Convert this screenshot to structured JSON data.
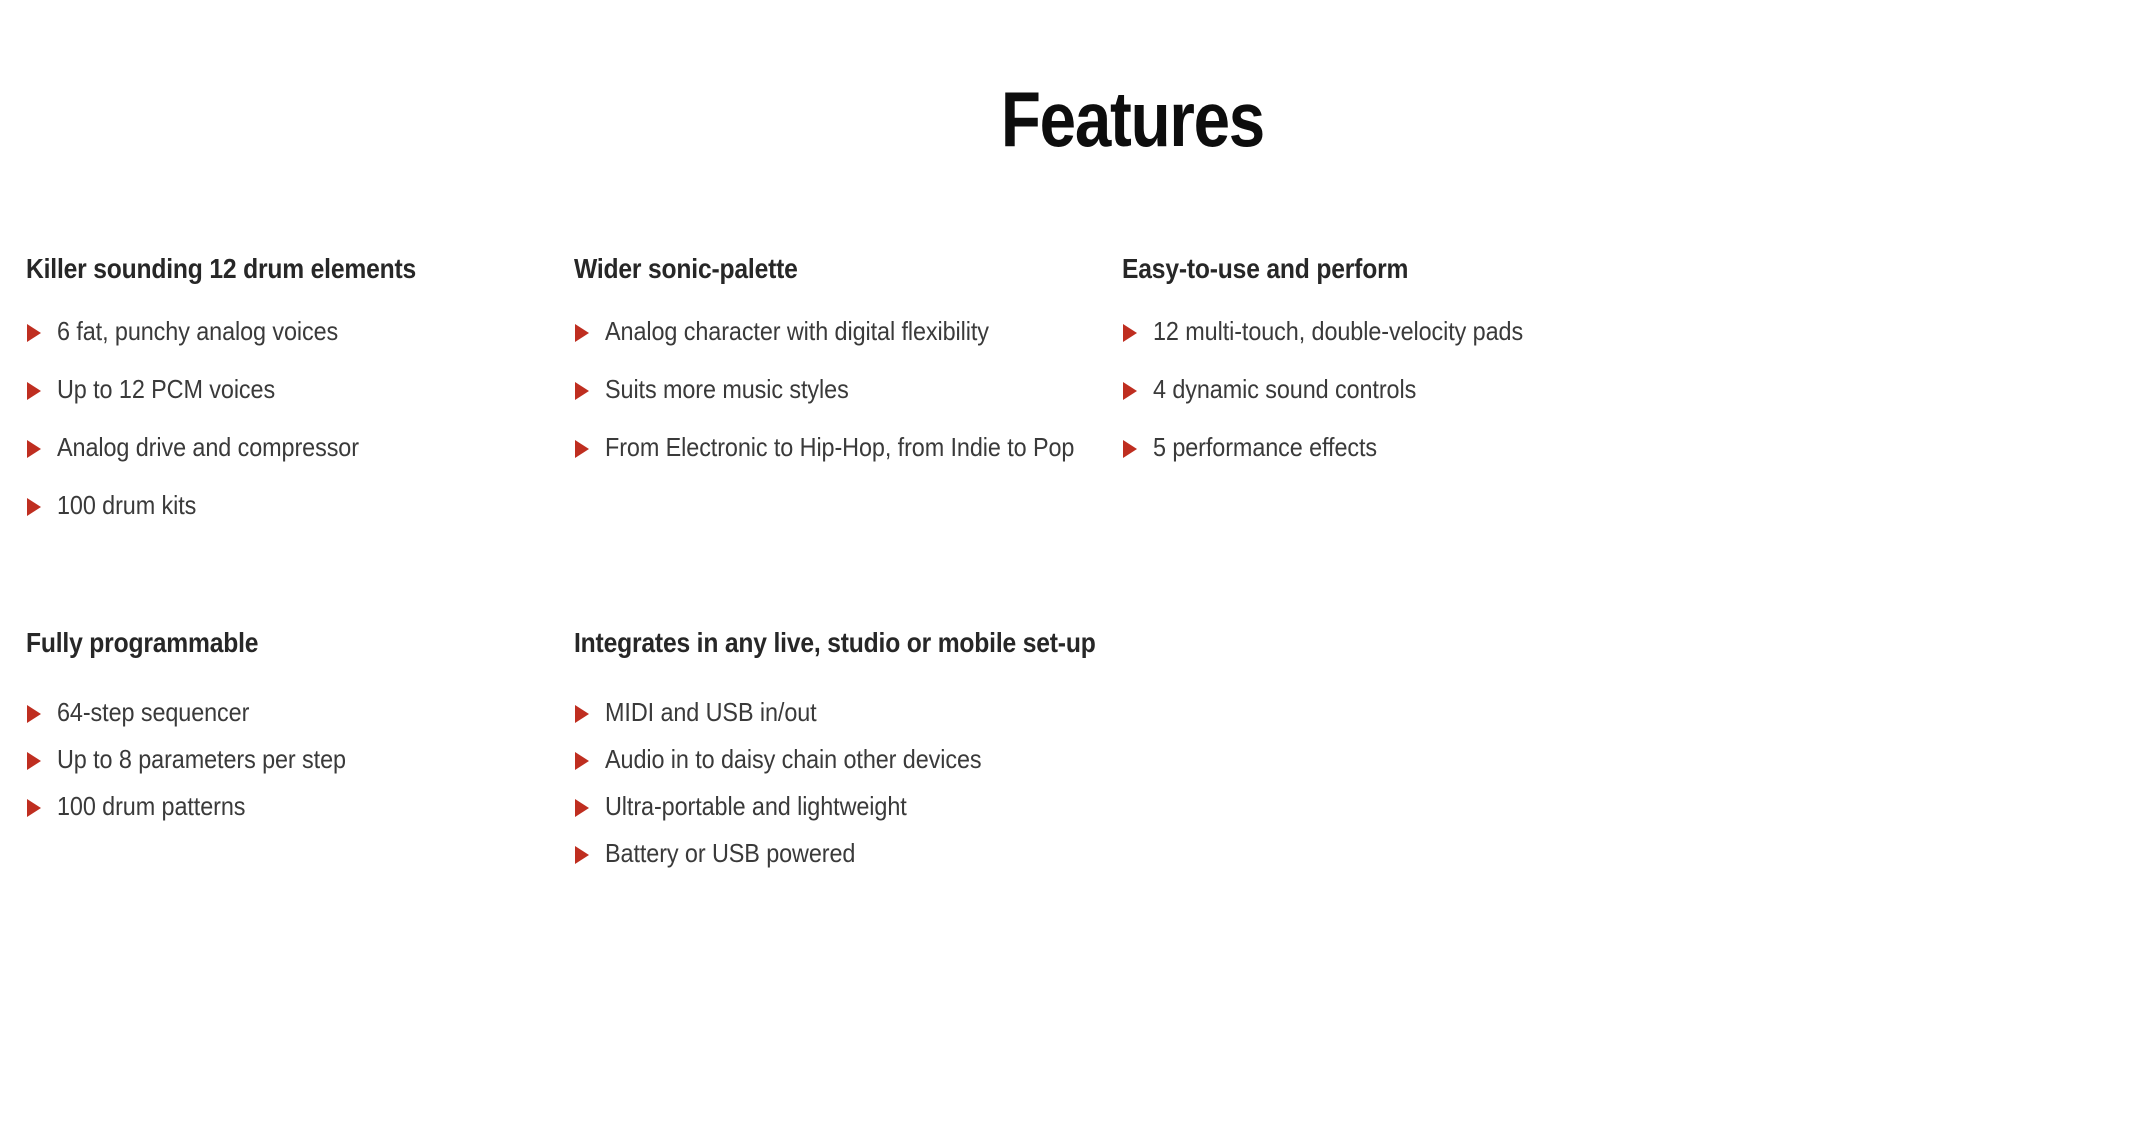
{
  "title": "Features",
  "colors": {
    "bullet": "#bf2e20",
    "heading": "#272727",
    "title": "#0d0d0d",
    "body": "#3a3a3a",
    "background": "#ffffff"
  },
  "icons": {
    "bullet": "triangle-right-icon"
  },
  "rows": [
    {
      "columns": [
        {
          "heading": "Killer sounding 12 drum elements",
          "items": [
            "6 fat, punchy analog voices",
            "Up to 12 PCM voices",
            "Analog drive and compressor",
            "100 drum kits"
          ]
        },
        {
          "heading": "Wider sonic-palette",
          "items": [
            "Analog character with digital flexibility",
            "Suits more music styles",
            "From Electronic to Hip-Hop, from Indie to Pop"
          ]
        },
        {
          "heading": "Easy-to-use and perform",
          "items": [
            "12 multi-touch, double-velocity pads",
            "4 dynamic sound controls",
            "5 performance effects"
          ]
        }
      ]
    },
    {
      "columns": [
        {
          "heading": "Fully programmable",
          "items": [
            "64-step sequencer",
            "Up to 8 parameters per step",
            "100 drum patterns"
          ]
        },
        {
          "heading": "Integrates in any live, studio or mobile set-up",
          "items": [
            "MIDI and USB in/out",
            "Audio in to daisy chain other devices",
            "Ultra-portable and lightweight",
            "Battery or USB powered"
          ]
        },
        {
          "heading": "",
          "items": []
        }
      ]
    }
  ]
}
